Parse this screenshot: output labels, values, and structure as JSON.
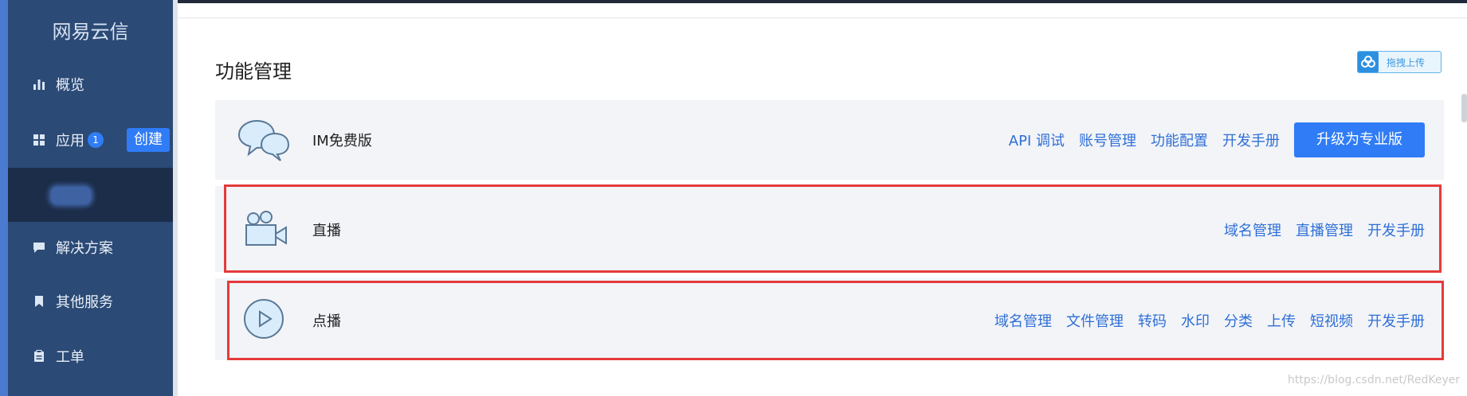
{
  "sidebar": {
    "brand": "网易云信",
    "items": [
      {
        "label": "概览",
        "icon": "bar-chart-icon"
      },
      {
        "label": "应用",
        "icon": "grid-icon",
        "badge": "1"
      },
      {
        "label": "解决方案",
        "icon": "comment-icon"
      },
      {
        "label": "其他服务",
        "icon": "bookmark-icon"
      },
      {
        "label": "工单",
        "icon": "clipboard-icon"
      }
    ],
    "create_label": "创建"
  },
  "main": {
    "title": "功能管理",
    "upload_label": "拖拽上传",
    "cards": [
      {
        "name": "IM免费版",
        "icon": "chat-bubbles-icon",
        "links": [
          "API 调试",
          "账号管理",
          "功能配置",
          "开发手册"
        ],
        "button": "升级为专业版"
      },
      {
        "name": "直播",
        "icon": "video-camera-icon",
        "links": [
          "域名管理",
          "直播管理",
          "开发手册"
        ]
      },
      {
        "name": "点播",
        "icon": "play-circle-icon",
        "links": [
          "域名管理",
          "文件管理",
          "转码",
          "水印",
          "分类",
          "上传",
          "短视频",
          "开发手册"
        ]
      }
    ]
  },
  "watermark": "https://blog.csdn.net/RedKeyer",
  "colors": {
    "accent": "#2f7cf6",
    "sidebar": "#2b4a75",
    "highlight": "#e53a3a",
    "link": "#2f6fd6"
  }
}
